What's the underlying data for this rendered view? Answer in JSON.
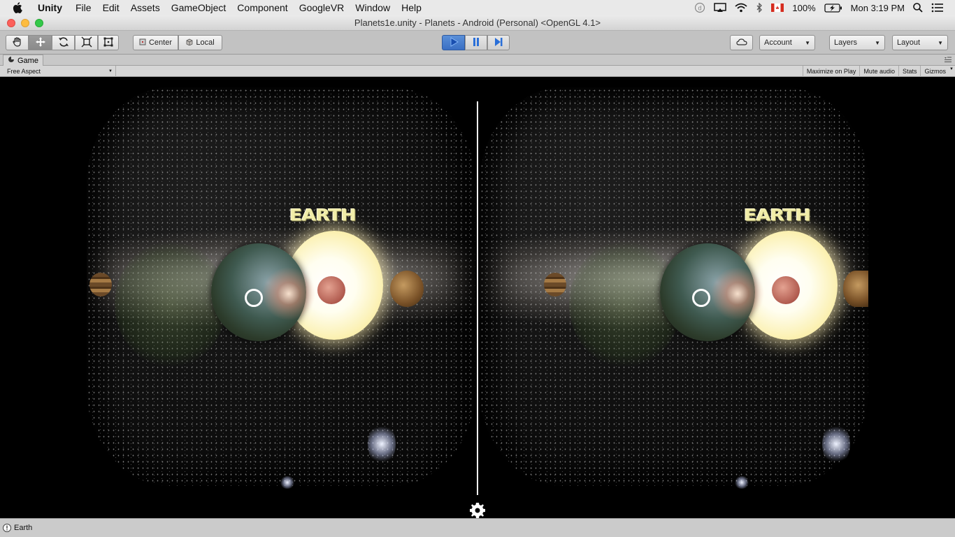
{
  "menubar": {
    "app_name": "Unity",
    "items": [
      "File",
      "Edit",
      "Assets",
      "GameObject",
      "Component",
      "GoogleVR",
      "Window",
      "Help"
    ],
    "battery": "100%",
    "clock": "Mon 3:19 PM"
  },
  "window": {
    "title": "Planets1e.unity - Planets - Android (Personal) <OpenGL 4.1>"
  },
  "toolbar": {
    "pivot_label": "Center",
    "space_label": "Local",
    "account_label": "Account",
    "layers_label": "Layers",
    "layout_label": "Layout"
  },
  "game_view": {
    "tab_label": "Game",
    "aspect_label": "Free Aspect",
    "options": [
      "Maximize on Play",
      "Mute audio",
      "Stats",
      "Gizmos"
    ]
  },
  "scene": {
    "left_label": "EARTH",
    "right_label": "EARTH"
  },
  "statusbar": {
    "message": "Earth"
  },
  "colors": {
    "toolbar_bg": "#c2c2c2",
    "play_active": "#3a6fc4",
    "label_yellow": "#f1eda8"
  }
}
